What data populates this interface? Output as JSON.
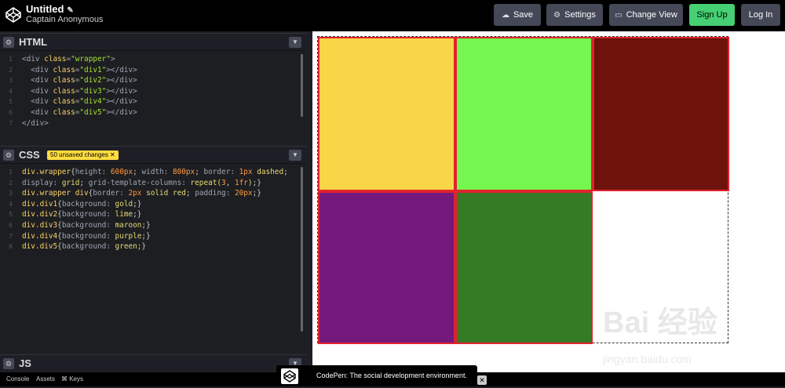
{
  "header": {
    "title": "Untitled",
    "author": "Captain Anonymous",
    "buttons": {
      "save": "Save",
      "settings": "Settings",
      "change_view": "Change View",
      "sign_up": "Sign Up",
      "log_in": "Log In"
    }
  },
  "html_panel": {
    "name": "HTML",
    "lines": [
      "<div class=\"wrapper\">",
      "  <div class=\"div1\"></div>",
      "  <div class=\"div2\"></div>",
      "  <div class=\"div3\"></div>",
      "  <div class=\"div4\"></div>",
      "  <div class=\"div5\"></div>",
      "</div>"
    ]
  },
  "css_panel": {
    "name": "CSS",
    "badge": "50 unsaved changes ✕",
    "lines": [
      "div.wrapper{height: 600px; width: 800px; border: 1px dashed;",
      "display: grid; grid-template-columns: repeat(3, 1fr);}",
      "div.wrapper div{border: 2px solid red; padding: 20px;}",
      "div.div1{background: gold;}",
      "div.div2{background: lime;}",
      "div.div3{background: maroon;}",
      "div.div4{background: purple;}",
      "div.div5{background: green;}"
    ]
  },
  "js_panel": {
    "name": "JS"
  },
  "footer": {
    "console": "Console",
    "assets": "Assets",
    "keys": "⌘ Keys"
  },
  "toast": {
    "message": "CodePen: The social development environment."
  },
  "watermark": {
    "brand": "Bai 经验",
    "url": "jingyan.baidu.com"
  },
  "colors": {
    "gold": "#f9d548",
    "lime": "#76f74f",
    "maroon": "#6e120c",
    "purple": "#74187b",
    "green": "#357a25",
    "signup": "#47cf73"
  }
}
